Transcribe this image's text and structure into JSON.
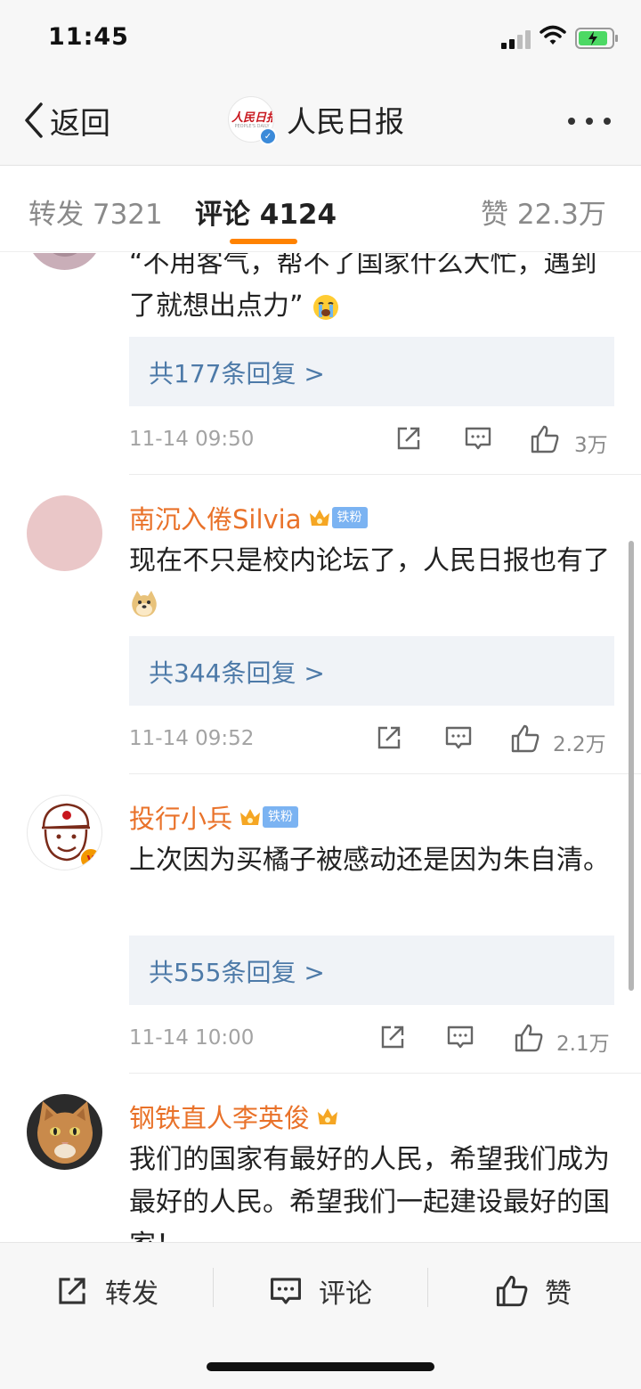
{
  "status_bar": {
    "time": "11:45",
    "battery_charging": true
  },
  "nav": {
    "back_label": "返回",
    "account_name": "人民日报",
    "logo_text": "人民日报",
    "logo_sub": "PEOPLE'S DAILY"
  },
  "tabs": [
    {
      "label": "转发 7321",
      "active": false
    },
    {
      "label": "评论 4124",
      "active": true
    },
    {
      "label": "赞 22.3万",
      "active": false
    }
  ],
  "accent_color": "#ff8200",
  "username_color": "#e9722a",
  "reply_link_color": "#4d7aa8",
  "comments": [
    {
      "username": "",
      "text": "“不用客气，帮不了国家什么大忙，遇到了就想出点力”",
      "emoji": "crying-face",
      "replies": "共177条回复 >",
      "timestamp": "11-14 09:50",
      "likes": "3万"
    },
    {
      "username": "南沉入倦Silvia",
      "badge": "铁粉",
      "text": "现在不只是校内论坛了，人民日报也有了",
      "emoji": "doge-face",
      "replies": "共344条回复 >",
      "timestamp": "11-14 09:52",
      "likes": "2.2万"
    },
    {
      "username": "投行小兵",
      "badge": "铁粉",
      "text": "上次因为买橘子被感动还是因为朱自清。",
      "replies": "共555条回复 >",
      "timestamp": "11-14 10:00",
      "likes": "2.1万"
    },
    {
      "username": "钢铁直人李英俊",
      "text": "我们的国家有最好的人民，希望我们成为最好的人民。希望我们一起建设最好的国家！"
    }
  ],
  "bottom_bar": {
    "repost_label": "转发",
    "comment_label": "评论",
    "like_label": "赞"
  }
}
